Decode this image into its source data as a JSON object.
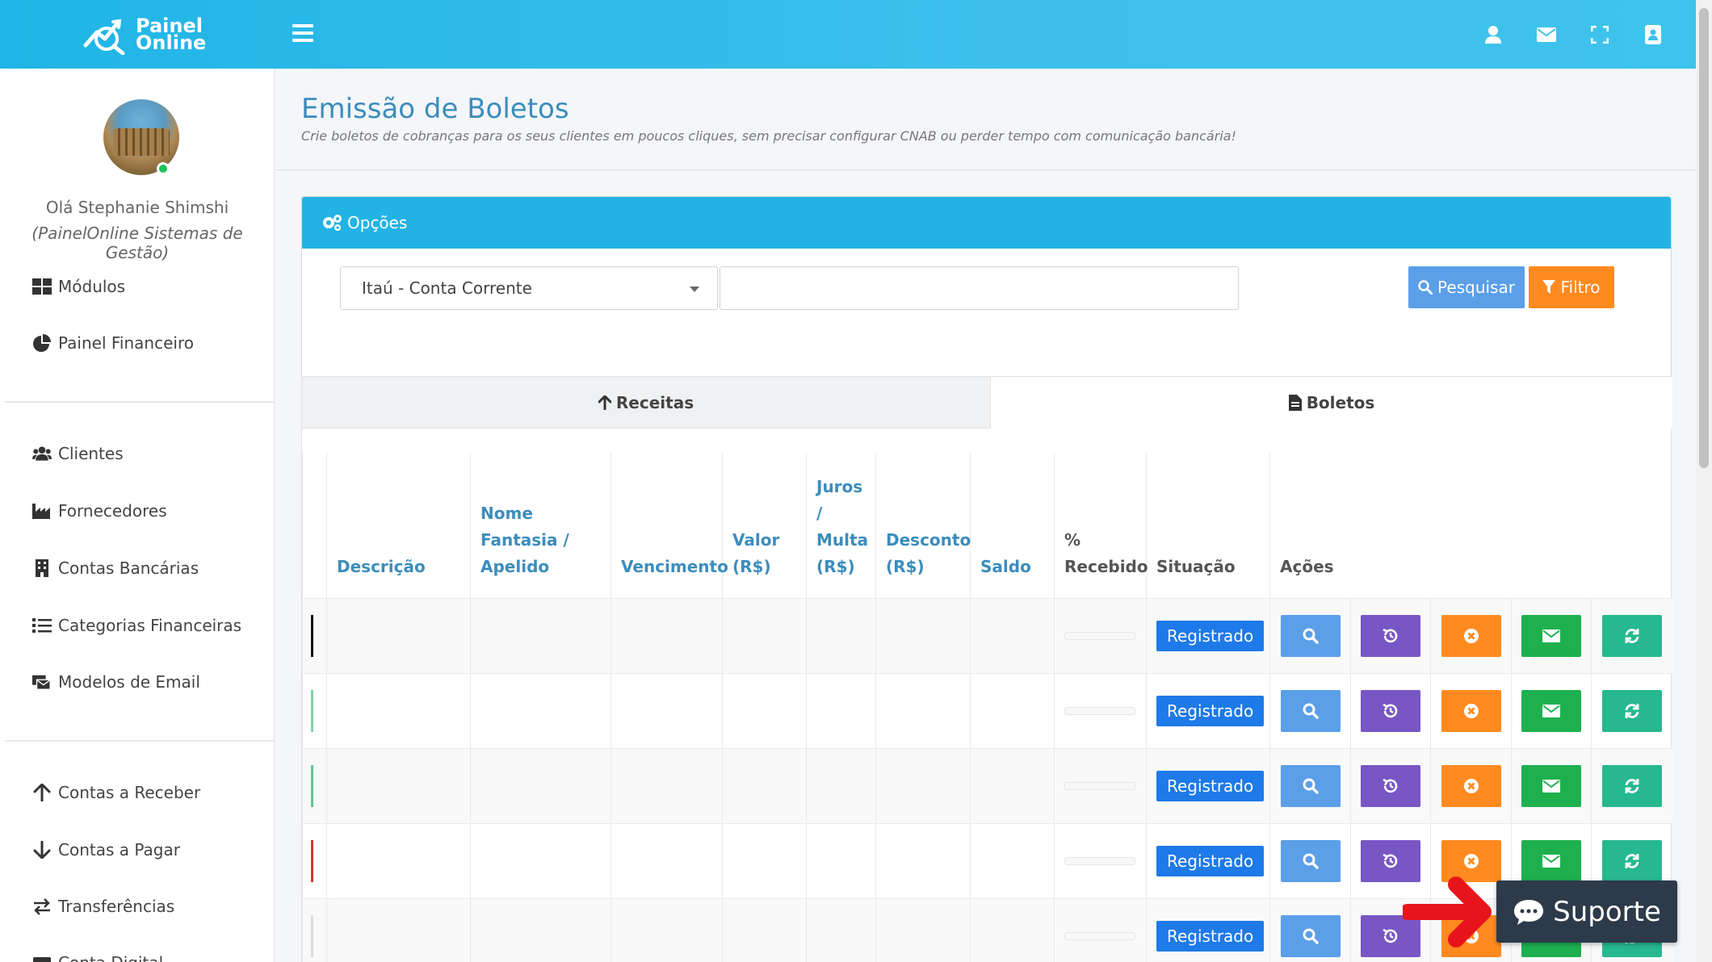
{
  "brand": {
    "line1": "Painel",
    "line2": "Online"
  },
  "topbar": {
    "icons": [
      "user-icon",
      "envelope-icon",
      "fullscreen-icon",
      "contact-card-icon"
    ]
  },
  "sidebar": {
    "greeting": "Olá Stephanie Shimshi",
    "company": "(PainelOnline Sistemas de Gestão)",
    "group1": [
      {
        "label": "Módulos",
        "icon": "grid-icon"
      },
      {
        "label": "Painel Financeiro",
        "icon": "pie-chart-icon"
      }
    ],
    "group2": [
      {
        "label": "Clientes",
        "icon": "users-icon"
      },
      {
        "label": "Fornecedores",
        "icon": "industry-icon"
      },
      {
        "label": "Contas Bancárias",
        "icon": "building-icon"
      },
      {
        "label": "Categorias Financeiras",
        "icon": "list-icon"
      },
      {
        "label": "Modelos de Email",
        "icon": "email-templates-icon"
      }
    ],
    "group3": [
      {
        "label": "Contas a Receber",
        "icon": "arrow-up-icon"
      },
      {
        "label": "Contas a Pagar",
        "icon": "arrow-down-icon"
      },
      {
        "label": "Transferências",
        "icon": "exchange-icon"
      },
      {
        "label": "Conta Digital",
        "icon": "wallet-icon"
      }
    ]
  },
  "page": {
    "title": "Emissão de Boletos",
    "subtitle": "Crie boletos de cobranças para os seus clientes em poucos cliques, sem precisar configurar CNAB ou perder tempo com comunicação bancária!"
  },
  "options": {
    "header": "Opções",
    "account_select": "Itaú - Conta Corrente",
    "search_value": "",
    "search_button": "Pesquisar",
    "filter_button": "Filtro"
  },
  "tabs": {
    "receitas": "Receitas",
    "boletos": "Boletos"
  },
  "table": {
    "headers": {
      "descricao": "Descrição",
      "nome_fantasia": "Nome Fantasia / Apelido",
      "vencimento": "Vencimento",
      "valor": "Valor (R$)",
      "juros": "Juros / Multa (R$)",
      "desconto": "Desconto (R$)",
      "saldo": "Saldo",
      "recebido": "% Recebido",
      "situacao": "Situação",
      "acoes": "Ações"
    },
    "rows": [
      {
        "status": "Registrado",
        "mark_color": "#111111"
      },
      {
        "status": "Registrado",
        "mark_color": "#7fd1a6"
      },
      {
        "status": "Registrado",
        "mark_color": "#5fc78f"
      },
      {
        "status": "Registrado",
        "mark_color": "#d6362d"
      },
      {
        "status": "Registrado",
        "mark_color": "#dddddd"
      }
    ],
    "actions": [
      "search-icon",
      "history-icon",
      "cancel-icon",
      "envelope-icon",
      "refresh-icon"
    ]
  },
  "support": {
    "label": "Suporte"
  },
  "colors": {
    "topbar": "#1fb5e6",
    "primary": "#3c8dbc",
    "status_blue": "#1e7ae8",
    "view": "#5a9fe8",
    "history": "#7856c4",
    "cancel": "#ff8a1f",
    "mail": "#1eb04e",
    "sync": "#27b88f",
    "support_bg": "#2d3a4a",
    "arrow": "#e8141b"
  }
}
